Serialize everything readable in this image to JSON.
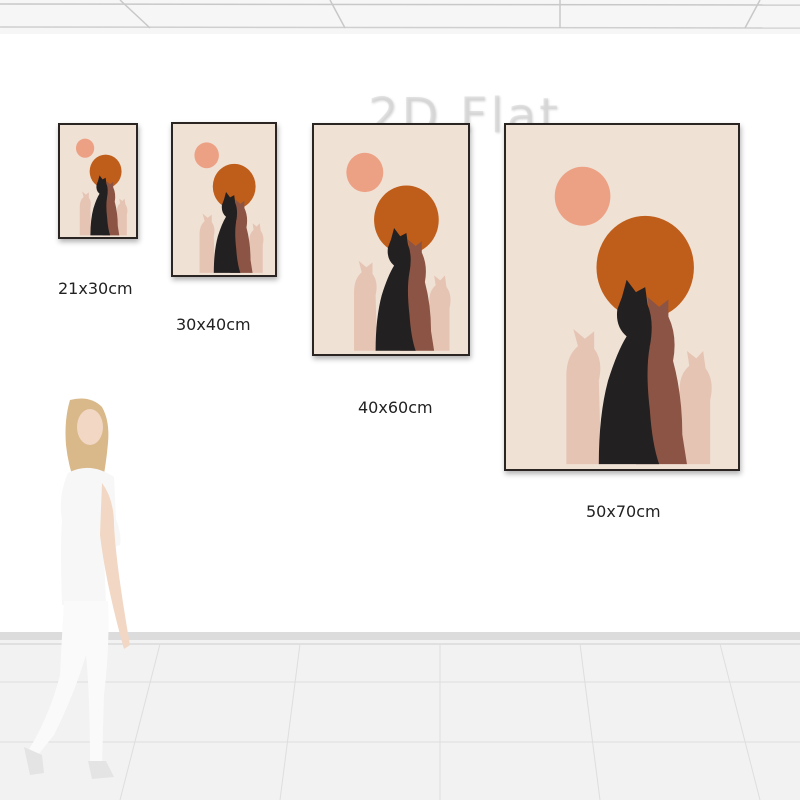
{
  "watermark": "2D Flat",
  "artwork": {
    "colors": {
      "background": "#f0e1d5",
      "pink_sun": "#eda184",
      "orange_sun": "#bf5e1b",
      "black_cat": "#222020",
      "brown_cat": "#8b5444",
      "pale_cat": "#e6c4b4"
    }
  },
  "sizes": [
    {
      "label": "21x30cm"
    },
    {
      "label": "30x40cm"
    },
    {
      "label": "40x60cm"
    },
    {
      "label": "50x70cm"
    }
  ]
}
